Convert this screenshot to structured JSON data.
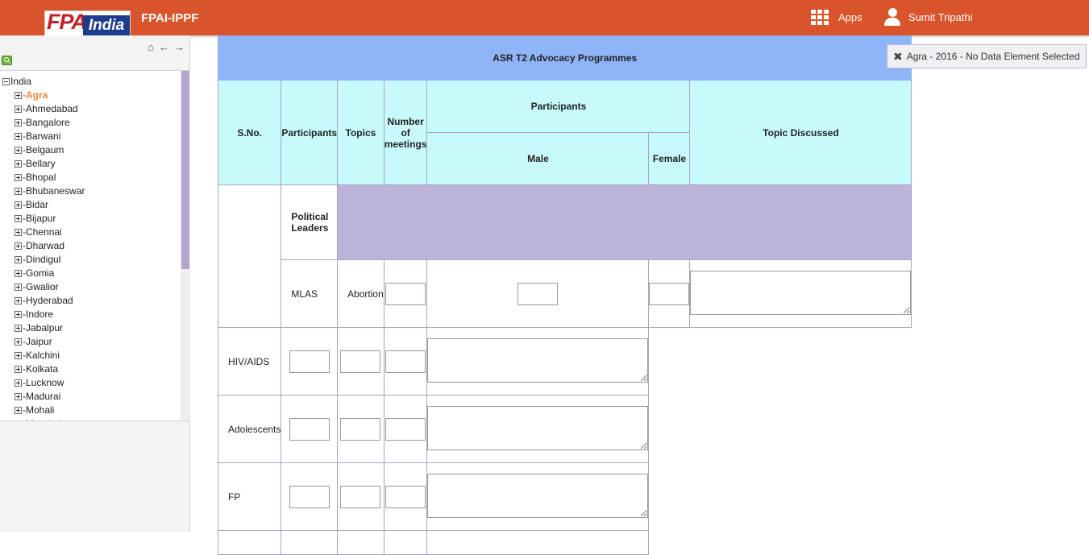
{
  "header": {
    "logo_left": "FPA",
    "logo_right": "India",
    "app_title": "FPAI-IPPF",
    "apps_label": "Apps",
    "user_label": "Sumit Tripathi",
    "bg_color": "#d9542a"
  },
  "left_panel": {
    "nav_icons": [
      "home-icon",
      "back-arrow-icon",
      "forward-arrow-icon"
    ],
    "tree": {
      "root": "India",
      "children": [
        {
          "label": "Agra",
          "selected": true
        },
        {
          "label": "Ahmedabad"
        },
        {
          "label": "Bangalore"
        },
        {
          "label": "Barwani"
        },
        {
          "label": "Belgaum"
        },
        {
          "label": "Bellary"
        },
        {
          "label": "Bhopal"
        },
        {
          "label": "Bhubaneswar"
        },
        {
          "label": "Bidar"
        },
        {
          "label": "Bijapur"
        },
        {
          "label": "Chennai"
        },
        {
          "label": "Dharwad"
        },
        {
          "label": "Dindigul"
        },
        {
          "label": "Gomia"
        },
        {
          "label": "Gwalior"
        },
        {
          "label": "Hyderabad"
        },
        {
          "label": "Indore"
        },
        {
          "label": "Jabalpur"
        },
        {
          "label": "Jaipur"
        },
        {
          "label": "Kalchini"
        },
        {
          "label": "Kolkata"
        },
        {
          "label": "Lucknow"
        },
        {
          "label": "Madurai"
        },
        {
          "label": "Mohali"
        },
        {
          "label": "Mumbai"
        }
      ]
    }
  },
  "report": {
    "title": "ASR T2 Advocacy Programmes",
    "headers": {
      "sno": "S.No.",
      "participants": "Participants",
      "topics": "Topics",
      "num_meetings": "Number of meetings",
      "participants_group": "Participants",
      "male": "Male",
      "female": "Female",
      "topic_discussed": "Topic Discussed"
    },
    "category": "Political Leaders",
    "group_label": "MLAS",
    "topics": [
      "Abortion",
      "HIV/AIDS",
      "Adolescents",
      "FP"
    ]
  },
  "status_bubble": "Agra - 2016 - No Data Element Selected"
}
